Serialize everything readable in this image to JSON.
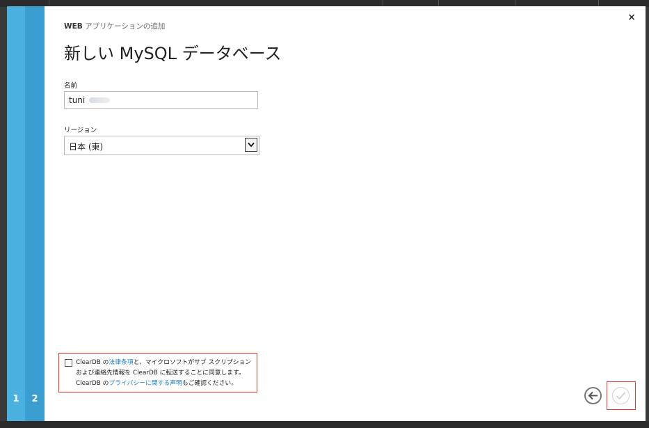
{
  "dialog": {
    "subtitle_bold": "WEB",
    "subtitle_rest": " アプリケーションの追加",
    "title": "新しい MySQL データベース",
    "close_glyph": "×"
  },
  "steps": [
    "1",
    "2"
  ],
  "form": {
    "name_label": "名前",
    "name_value": "tuni",
    "region_label": "リージョン",
    "region_value": "日本 (東)"
  },
  "consent": {
    "t1": "ClearDB の",
    "link1": "法律条項",
    "t2": "と、マイクロソフトがサブ スクリプション",
    "t3": "および連絡先情報を ClearDB に転送することに同意します。",
    "t4": "ClearDB の",
    "link2": "プライバシーに関する声明",
    "t5": "もご確認ください。"
  },
  "icons": {
    "close": "close-icon",
    "back": "arrow-left-icon",
    "ok": "checkmark-icon",
    "dropdown": "chevron-down-icon"
  },
  "colors": {
    "step1": "#4ab1e1",
    "step2": "#3b9ed1",
    "link": "#1e7fc6",
    "highlight": "#e53b2b"
  }
}
